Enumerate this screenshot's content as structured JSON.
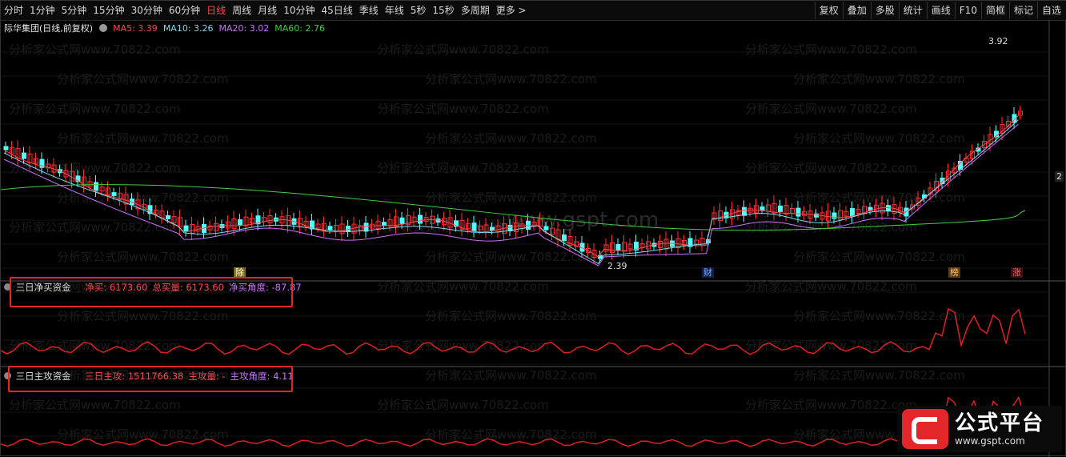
{
  "toolbar": {
    "periods": [
      "分时",
      "1分钟",
      "5分钟",
      "15分钟",
      "30分钟",
      "60分钟",
      "日线",
      "周线",
      "月线",
      "10分钟",
      "45日线",
      "季线",
      "年线",
      "5秒",
      "15秒",
      "多周期",
      "更多 >"
    ],
    "active_index": 6,
    "right_buttons": [
      "复权",
      "叠加",
      "多股",
      "统计",
      "画线",
      "F10",
      "简框",
      "标记",
      "自选"
    ]
  },
  "main": {
    "stock_title": "际华集团(日线,前复权)",
    "ma": [
      {
        "label": "MA5: 3.39",
        "color": "#ff4a4a"
      },
      {
        "label": "MA10: 3.26",
        "color": "#7fd8f0"
      },
      {
        "label": "MA20: 3.02",
        "color": "#d070ff"
      },
      {
        "label": "MA60: 2.76",
        "color": "#40d040"
      }
    ],
    "high_label": "3.92",
    "low_label": "2.39",
    "right_axis_label": "2",
    "markers": {
      "zhao": "除",
      "cai": "财",
      "bang": "榜",
      "zhang": "涨"
    }
  },
  "indicator1": {
    "title": "三日净买资金",
    "items": [
      {
        "label": "净买: 6173.60",
        "color": "#ff4a4a"
      },
      {
        "label": "总买量: 6173.60",
        "color": "#ff4a4a"
      },
      {
        "label": "净买角度: -87.87",
        "color": "#d070ff"
      }
    ]
  },
  "indicator2": {
    "title": "三日主攻资金",
    "items": [
      {
        "label": "三日主攻: 1511766.38",
        "color": "#ff4a4a"
      },
      {
        "label": "主攻量: -",
        "color": "#ff4a4a"
      },
      {
        "label": "主攻角度: 4.11",
        "color": "#d070ff"
      }
    ]
  },
  "watermark": {
    "text": "分析家公式网www.70822.com",
    "center": "www.gspt.com"
  },
  "logo": {
    "cn": "公式平台",
    "en": "www.gspt.com"
  },
  "colors": {
    "up": "#ff3030",
    "down": "#54ffff",
    "ma5": "#ff4a4a",
    "ma10": "#7fd8f0",
    "ma20": "#d070ff",
    "ma60": "#40d040",
    "ind": "#e02020"
  }
}
